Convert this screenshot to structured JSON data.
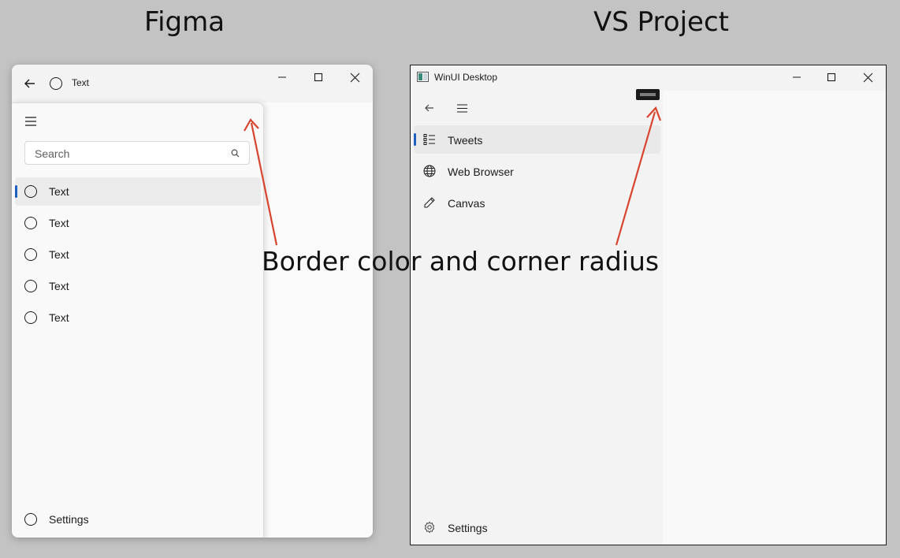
{
  "headings": {
    "left": "Figma",
    "right": "VS Project"
  },
  "figma": {
    "title": "Text",
    "search_placeholder": "Search",
    "items": [
      {
        "label": "Text",
        "selected": true
      },
      {
        "label": "Text",
        "selected": false
      },
      {
        "label": "Text",
        "selected": false
      },
      {
        "label": "Text",
        "selected": false
      },
      {
        "label": "Text",
        "selected": false
      }
    ],
    "settings_label": "Settings"
  },
  "vs": {
    "title": "WinUI Desktop",
    "items": [
      {
        "label": "Tweets",
        "icon": "list-icon",
        "selected": true
      },
      {
        "label": "Web Browser",
        "icon": "globe-icon",
        "selected": false
      },
      {
        "label": "Canvas",
        "icon": "pencil-icon",
        "selected": false
      }
    ],
    "settings_label": "Settings"
  },
  "annotation": "Border color and corner radius",
  "colors": {
    "accent": "#1e5fc0",
    "arrow": "#d9442f",
    "background": "#c3c3c3"
  }
}
